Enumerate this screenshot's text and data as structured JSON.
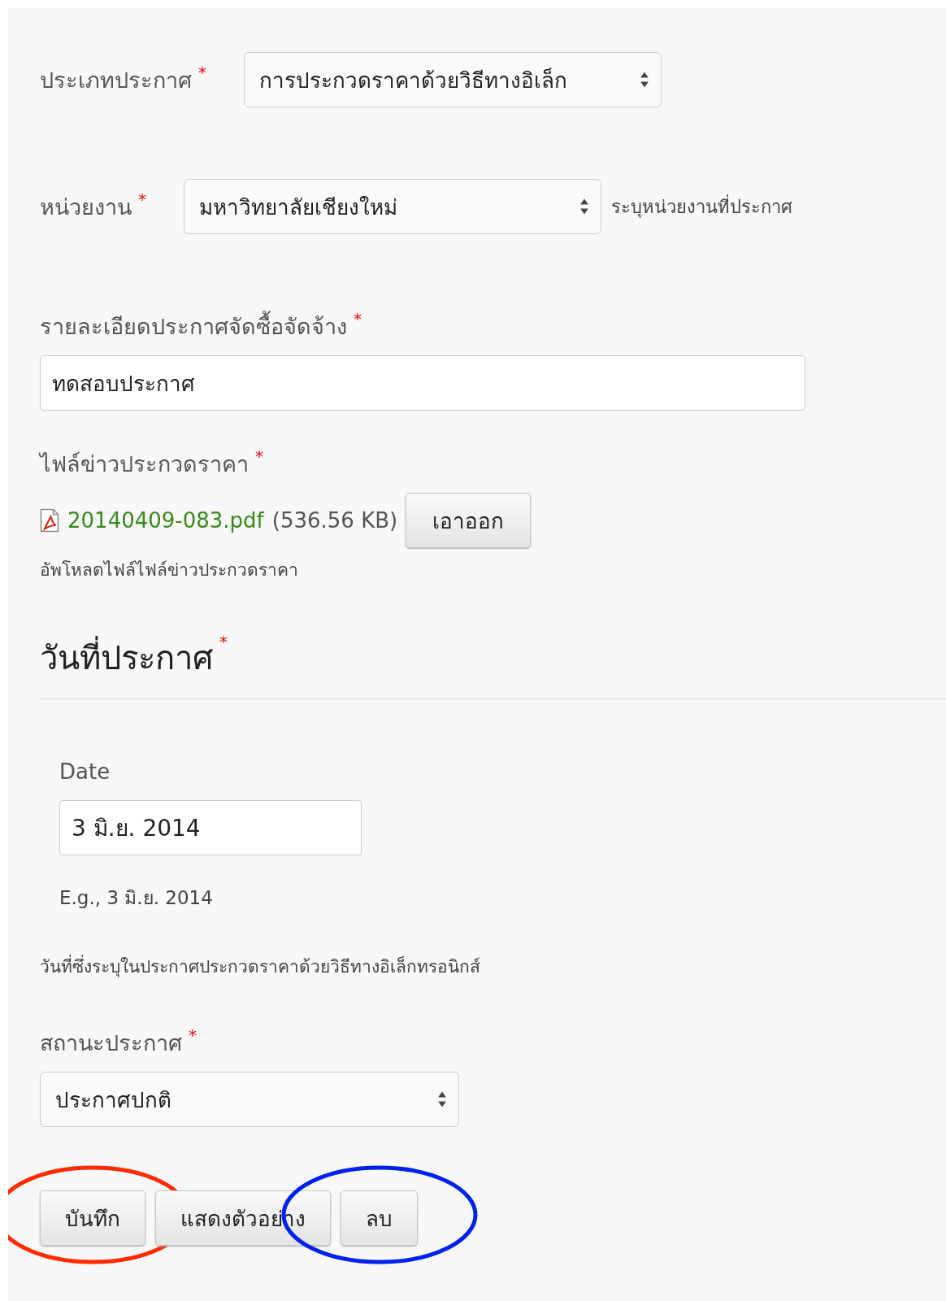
{
  "fields": [
    {
      "kind": "select",
      "label": "ประเภทประกาศ",
      "required": true,
      "inline": true,
      "value": "การประกวดราคาด้วยวิธีทางอิเล็ก"
    },
    {
      "kind": "select",
      "label": "หน่วยงาน",
      "required": true,
      "inline": true,
      "value": "มหาวิทยาลัยเชียงใหม่",
      "hint": "ระบุหน่วยงานที่ประกาศ"
    },
    {
      "kind": "text",
      "label": "รายละเอียดประกาศจัดซื้อจัดจ้าง",
      "required": true,
      "value": "ทดสอบประกาศ"
    },
    {
      "kind": "file",
      "label": "ไฟล์ข่าวประกวดราคา",
      "required": true,
      "file_name": "20140409-083.pdf",
      "file_size": "(536.56 KB)",
      "button": "เอาออก",
      "hint": "อัพโหลดไฟล์ไฟล์ข่าวประกวดราคา"
    },
    {
      "kind": "date",
      "heading": "วันที่ประกาศ",
      "required": true,
      "label": "Date",
      "value": "3 มิ.ย. 2014",
      "example": "E.g., 3 มิ.ย. 2014",
      "hint": "วันที่ซึ่งระบุในประกาศประกวดราคาด้วยวิธีทางอิเล็กทรอนิกส์"
    },
    {
      "kind": "select",
      "label": "สถานะประกาศ",
      "required": true,
      "inline": false,
      "value": "ประกาศปกติ"
    }
  ],
  "buttons": [
    {
      "label": "บันทึก",
      "color": "#ff2a00"
    },
    {
      "label": "แสดงตัวอย่าง"
    },
    {
      "label": "ลบ",
      "color": "#0022ee"
    }
  ],
  "required_mark": "*"
}
